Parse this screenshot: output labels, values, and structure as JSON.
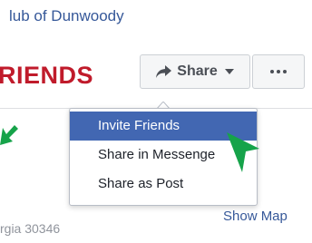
{
  "page": {
    "name_text": "lub of Dunwoody",
    "hero_text": "RIENDS"
  },
  "actions": {
    "share_label": "Share",
    "more_label": "•••"
  },
  "share_menu": {
    "items": [
      {
        "label": "Invite Friends",
        "active": true
      },
      {
        "label": "Share in Messenge",
        "active": false
      },
      {
        "label": "Share as Post",
        "active": false
      }
    ]
  },
  "location": {
    "address_text": "rgia 30346",
    "show_map_label": "Show Map"
  },
  "icons": {
    "share": "share-arrow-icon",
    "caret": "caret-down-icon",
    "more": "more-dots-icon",
    "annotation_arrow": "green-arrow-icon",
    "cursor": "green-pointer-icon"
  },
  "colors": {
    "link_blue": "#365899",
    "hero_red": "#c01b2b",
    "menu_active_bg": "#4267b2",
    "annotation_green": "#16a34a"
  }
}
